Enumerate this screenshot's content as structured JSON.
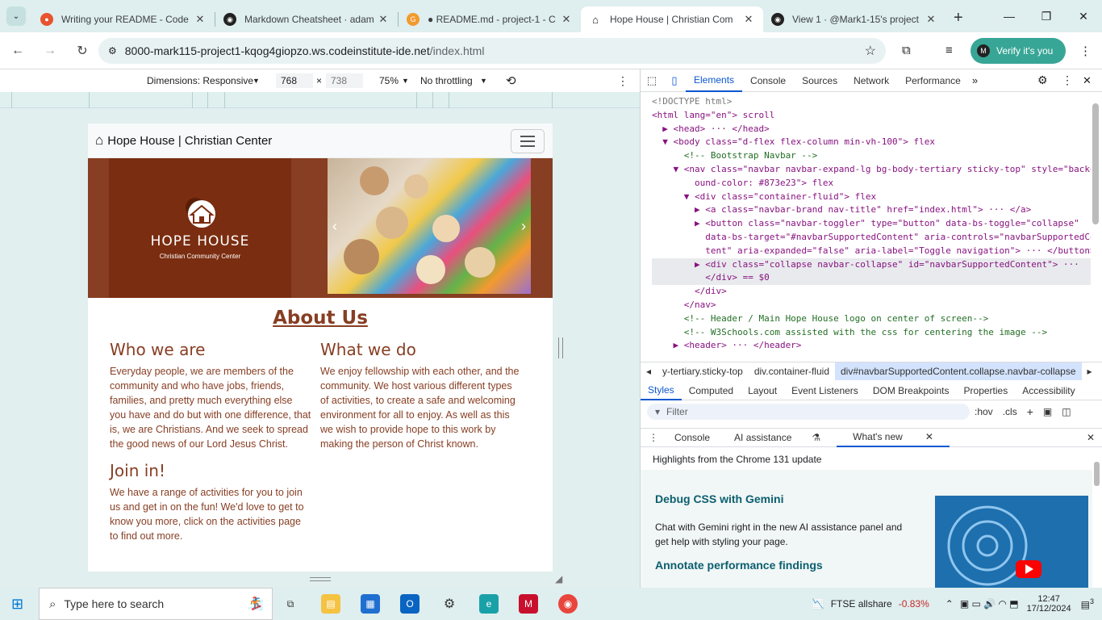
{
  "browser": {
    "tabs": [
      {
        "title": "Writing your README - Code",
        "icon": "codeinstitute-icon",
        "color": "#e8542e"
      },
      {
        "title": "Markdown Cheatsheet · adam",
        "icon": "github-icon",
        "color": "#222222"
      },
      {
        "title": "● README.md - project-1 - C",
        "icon": "gitpod-icon",
        "color": "#f29a2e"
      },
      {
        "title": "Hope House | Christian Com",
        "icon": "home-icon",
        "color": "#111111"
      },
      {
        "title": "View 1 · @Mark1-15's project",
        "icon": "github-icon",
        "color": "#222222"
      }
    ],
    "url_host": "8000-mark115-project1-kqog4giopzo.ws.codeinstitute-ide.net",
    "url_path": "/index.html",
    "verify_label": "Verify it's you",
    "avatar_letter": "M"
  },
  "device_toolbar": {
    "dimensions": "Dimensions: Responsive",
    "width": "768",
    "height": "738",
    "zoom": "75%",
    "throttle": "No throttling"
  },
  "site": {
    "brand": "Hope House | Christian Center",
    "logo_title": "HOPE HOUSE",
    "logo_sub": "Christian Community Center",
    "about_heading": "About Us",
    "who_heading": "Who we are",
    "who_text": "Everyday people, we are members of the community and who have jobs, friends, families, and pretty much everything else you have and do but with one difference, that is, we are Christians. And we seek to spread the good news of our Lord Jesus Christ.",
    "what_heading": "What we do",
    "what_text": "We enjoy fellowship with each other, and the community. We host various different types of activities, to create a safe and welcoming environment for all to enjoy. As well as this we wish to provide hope to this work by making the person of Christ known.",
    "join_heading": "Join in!",
    "join_text": "We have a range of activities for you to join us and get in on the fun! We'd love to get to know you more, click on the activities page to find out more.",
    "brand_color": "#873e23"
  },
  "devtools": {
    "tabs": [
      "Elements",
      "Console",
      "Sources",
      "Network",
      "Performance"
    ],
    "active_tab": "Elements",
    "dom_lines": [
      "<!DOCTYPE html>",
      "<html lang=\"en\"> scroll",
      "  ▶ <head> ··· </head>",
      "  ▼ <body class=\"d-flex flex-column min-vh-100\"> flex",
      "      <!-- Bootstrap Navbar -->",
      "    ▼ <nav class=\"navbar navbar-expand-lg bg-body-tertiary sticky-top\" style=\"backgr",
      "        ound-color: #873e23\"> flex",
      "      ▼ <div class=\"container-fluid\"> flex",
      "        ▶ <a class=\"navbar-brand nav-title\" href=\"index.html\"> ··· </a>",
      "        ▶ <button class=\"navbar-toggler\" type=\"button\" data-bs-toggle=\"collapse\"",
      "          data-bs-target=\"#navbarSupportedContent\" aria-controls=\"navbarSupportedCon",
      "          tent\" aria-expanded=\"false\" aria-label=\"Toggle navigation\"> ··· </button>",
      "        ▶ <div class=\"collapse navbar-collapse\" id=\"navbarSupportedContent\"> ···",
      "          </div> == $0",
      "        </div>",
      "      </nav>",
      "      <!-- Header / Main Hope House logo on center of screen-->",
      "      <!-- W3Schools.com assisted with the css for centering the image -->",
      "    ▶ <header> ··· </header>"
    ],
    "breadcrumbs": [
      "y-tertiary.sticky-top",
      "div.container-fluid",
      "div#navbarSupportedContent.collapse.navbar-collapse"
    ],
    "style_tabs": [
      "Styles",
      "Computed",
      "Layout",
      "Event Listeners",
      "DOM Breakpoints",
      "Properties",
      "Accessibility"
    ],
    "filter_placeholder": "Filter",
    "hov": ":hov",
    "cls": ".cls",
    "drawer_tabs": [
      "Console",
      "AI assistance",
      "What's new"
    ],
    "whats_new_head": "Highlights from the Chrome 131 update",
    "wn1_title": "Debug CSS with Gemini",
    "wn1_text": "Chat with Gemini right in the new AI assistance panel and get help with styling your page.",
    "wn2_title": "Annotate performance findings"
  },
  "taskbar": {
    "search_placeholder": "Type here to search",
    "stock_name": "FTSE allshare",
    "stock_change": "-0.83%",
    "time": "12:47",
    "date": "17/12/2024",
    "notif_count": "3"
  }
}
